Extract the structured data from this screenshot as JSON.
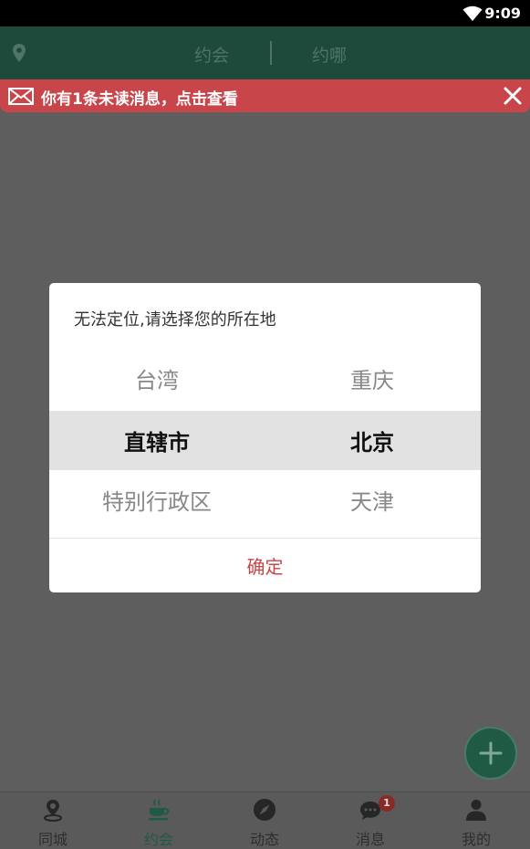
{
  "status_bar": {
    "time": "9:09",
    "icons": [
      "wifi-icon"
    ]
  },
  "top_bar": {
    "location_icon": "map-pin-icon",
    "tabs": [
      {
        "label": "约会"
      },
      {
        "label": "约哪"
      }
    ]
  },
  "notice": {
    "icon": "mail-icon",
    "text": "你有1条未读消息，点击查看",
    "close_icon": "close-icon"
  },
  "dialog": {
    "title": "无法定位,请选择您的所在地",
    "rows": [
      {
        "left": "台湾",
        "right": "重庆"
      },
      {
        "left": "直辖市",
        "right": "北京"
      },
      {
        "left": "特别行政区",
        "right": "天津"
      }
    ],
    "selected": {
      "province": "直辖市",
      "city": "北京"
    },
    "confirm_label": "确定"
  },
  "fab": {
    "icon": "plus-icon"
  },
  "bottom_nav": {
    "items": [
      {
        "label": "同城",
        "icon": "location-icon"
      },
      {
        "label": "约会",
        "icon": "coffee-cup-icon",
        "active": true
      },
      {
        "label": "动态",
        "icon": "compass-icon"
      },
      {
        "label": "消息",
        "icon": "chat-icon",
        "badge": "1"
      },
      {
        "label": "我的",
        "icon": "person-icon"
      }
    ]
  },
  "colors": {
    "top_bar_bg": "#1e4a3c",
    "notice_bg": "#c8454a",
    "accent_green": "#1e5a44",
    "confirm_red": "#c8454a",
    "overlay": "#5e5e5e"
  }
}
